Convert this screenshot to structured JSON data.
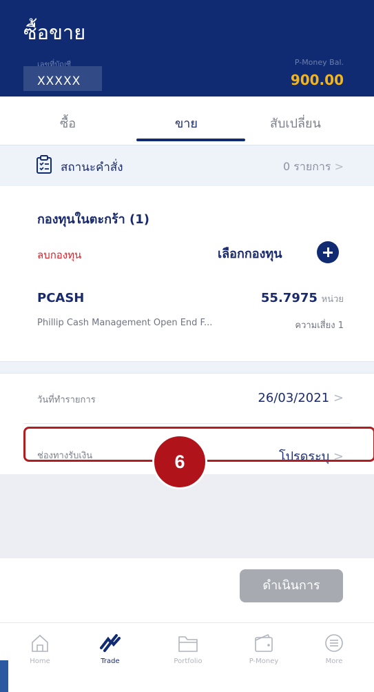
{
  "header": {
    "title": "ซื้อขาย",
    "account_label": "เลขที่บัญชี",
    "account_value": "XXXXX",
    "pmoney_label": "P-Money Bal.",
    "pmoney_value": "900.00"
  },
  "tabs": [
    {
      "label": "ซื้อ",
      "active": false
    },
    {
      "label": "ขาย",
      "active": true
    },
    {
      "label": "สับเปลี่ยน",
      "active": false
    }
  ],
  "order_status": {
    "label": "สถานะคำสั่ง",
    "count": "0 รายการ",
    "icon": "clipboard-icon"
  },
  "basket": {
    "title": "กองทุนในตะกร้า (1)",
    "remove_label": "ลบกองทุน",
    "choose_label": "เลือกกองทุน",
    "fund": {
      "code": "PCASH",
      "units": "55.7975",
      "unit_label": "หน่วย",
      "name": "Phillip Cash Management Open End F...",
      "risk": "ความเสี่ยง 1"
    }
  },
  "transaction": {
    "date_label": "วันที่ทำรายการ",
    "date_value": "26/03/2021",
    "channel_label": "ช่องทางรับเงิน",
    "channel_value": "โปรดระบุ"
  },
  "step_marker": "6",
  "proceed_label": "ดำเนินการ",
  "nav": [
    {
      "label": "Home",
      "icon": "home-icon",
      "active": false
    },
    {
      "label": "Trade",
      "icon": "trade-icon",
      "active": true
    },
    {
      "label": "Portfolio",
      "icon": "folder-icon",
      "active": false
    },
    {
      "label": "P-Money",
      "icon": "wallet-icon",
      "active": false
    },
    {
      "label": "More",
      "icon": "menu-icon",
      "active": false
    }
  ],
  "colors": {
    "header_bg": "#102b72",
    "balance": "#f3b51d",
    "remove": "#d1242c",
    "highlight": "#b11d20",
    "badge": "#b0131a"
  }
}
